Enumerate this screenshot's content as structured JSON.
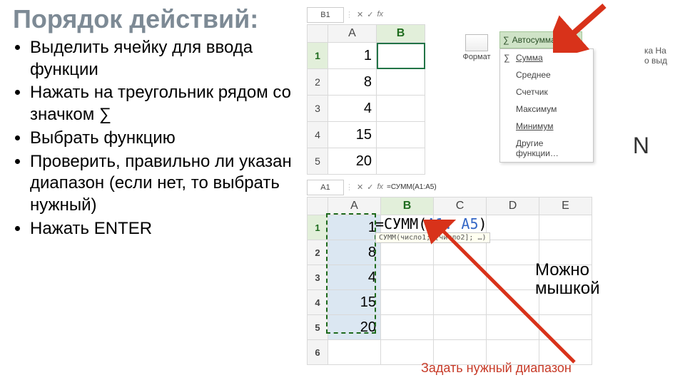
{
  "title": "Порядок действий:",
  "bullets": [
    "Выделить ячейку для ввода функции",
    "Нажать на  треугольник рядом со значком ∑",
    "Выбрать функцию",
    "Проверить, правильно ли указан диапазон (если нет, то выбрать нужный)",
    "Нажать ENTER"
  ],
  "top_excel": {
    "name_box": "B1",
    "fx": "fx",
    "cols": [
      "A",
      "B"
    ],
    "active_col": "B",
    "rows": [
      {
        "n": "1",
        "A": "1",
        "B": ""
      },
      {
        "n": "2",
        "A": "8",
        "B": ""
      },
      {
        "n": "3",
        "A": "4",
        "B": ""
      },
      {
        "n": "4",
        "A": "15",
        "B": ""
      },
      {
        "n": "5",
        "A": "20",
        "B": ""
      }
    ],
    "active_row": "1",
    "format_label": "Формат",
    "autosum_label": "Автосумма",
    "autosum_menu": [
      "Сумма",
      "Среднее",
      "Счетчик",
      "Максимум",
      "Минимум",
      "Другие функции…"
    ],
    "ribbon_cut1": "ка   На",
    "ribbon_cut2": "о    выд",
    "big_letter": "N"
  },
  "bottom_excel": {
    "name_box": "A1",
    "fx": "fx",
    "fx_value": "=СУММ(A1:A5)",
    "cols": [
      "A",
      "B",
      "C",
      "D",
      "E"
    ],
    "active_col": "B",
    "rows": [
      {
        "n": "1",
        "A": "1"
      },
      {
        "n": "2",
        "A": "8"
      },
      {
        "n": "3",
        "A": "4"
      },
      {
        "n": "4",
        "A": "15"
      },
      {
        "n": "5",
        "A": "20"
      },
      {
        "n": "6",
        "A": ""
      }
    ],
    "active_row": "1",
    "formula_prefix": "=СУММ(",
    "formula_range": "A1: A5",
    "formula_suffix": ")",
    "formula_tip": "СУММ(число1; [число2]; …)"
  },
  "annotations": {
    "mouse1": "Можно",
    "mouse2": "мышкой",
    "range_hint": "Задать нужный диапазон"
  }
}
